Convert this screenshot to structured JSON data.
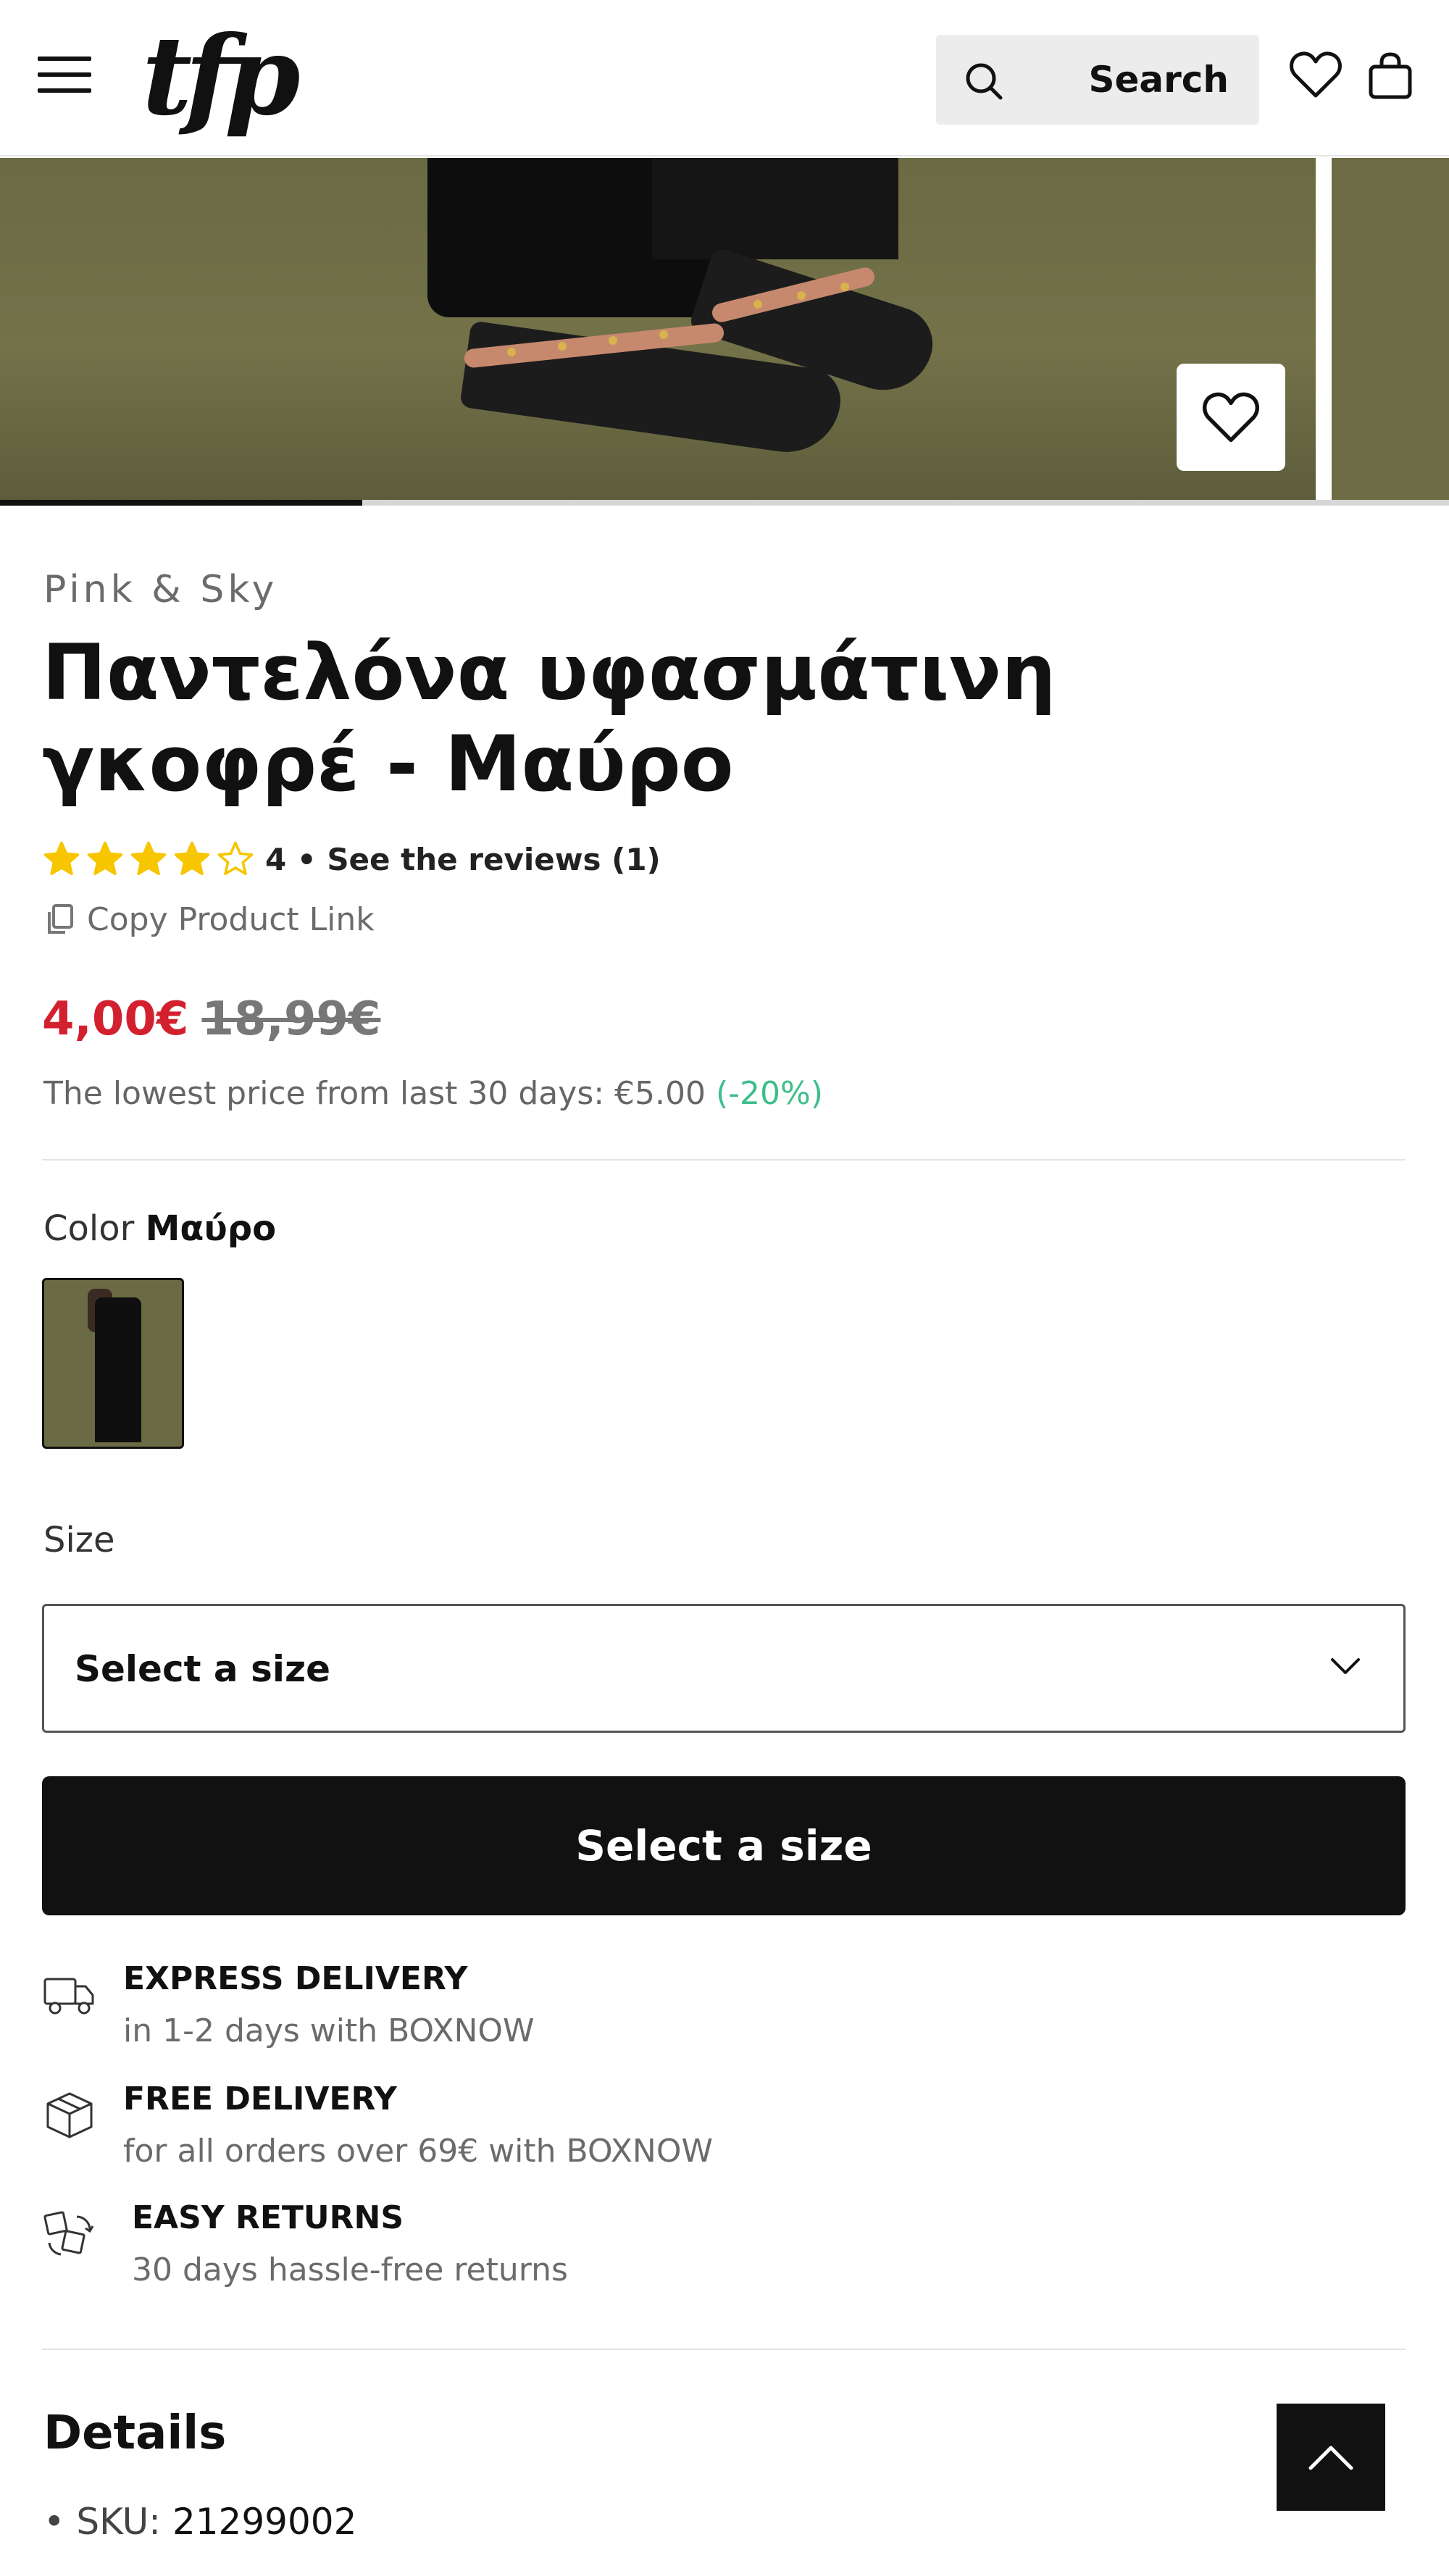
{
  "header": {
    "logo_text": "tfp",
    "search_label": "Search",
    "icons": [
      "menu-icon",
      "search-icon",
      "heart-icon",
      "bag-icon"
    ]
  },
  "product": {
    "brand": "Pink & Sky",
    "title": "Παντελόνα υφασμάτινη γκοφρέ - Μαύρο",
    "rating_value": 4,
    "rating_max": 5,
    "rating_text": "4 • See the reviews (1)",
    "copy_link": "Copy Product Link",
    "price_now": "4,00€",
    "price_old": "18,99€",
    "lowest_text": "The lowest price from last 30 days: €5.00",
    "lowest_pct": "(-20%)",
    "color_label": "Color",
    "color_value": "Μαύρο",
    "size_label": "Size",
    "size_placeholder": "Select a size",
    "cta_label": "Select a size",
    "gallery_progress": 0.25
  },
  "features": [
    {
      "title": "EXPRESS DELIVERY",
      "subtitle": "in 1-2 days with BOXNOW",
      "icon": "delivery-truck-icon"
    },
    {
      "title": "FREE DELIVERY",
      "subtitle": "for all orders over 69€ with BOXNOW",
      "icon": "package-box-icon"
    },
    {
      "title": "EASY RETURNS",
      "subtitle": "30 days hassle-free returns",
      "icon": "returns-boxes-icon"
    }
  ],
  "details": {
    "heading": "Details",
    "sku_label": "SKU:",
    "sku_value": "21299002"
  },
  "colors": {
    "accent_red": "#d3202f",
    "discount_green": "#3dbe8b",
    "star_yellow": "#f7c600",
    "cta_black": "#111111"
  }
}
